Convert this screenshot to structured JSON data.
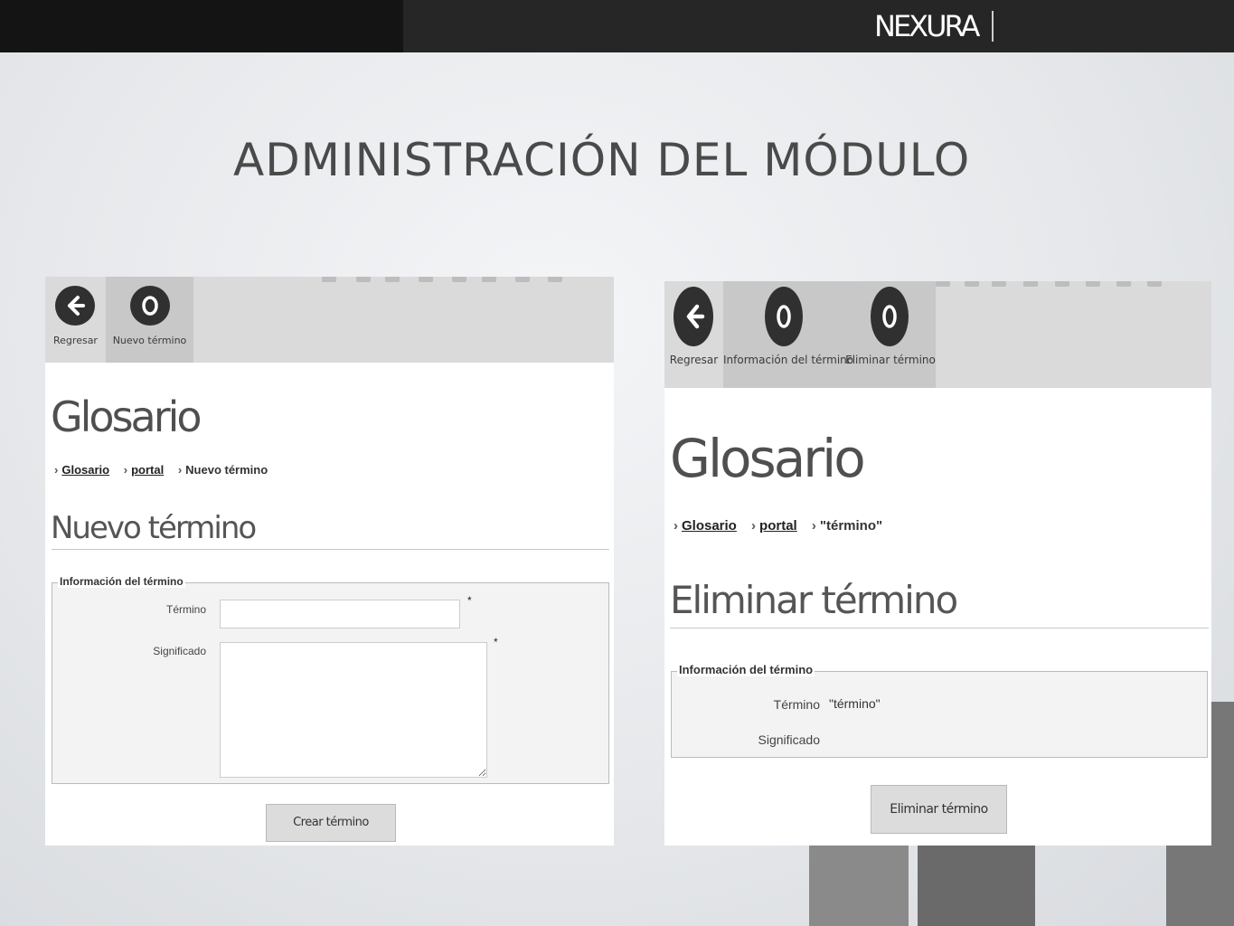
{
  "brand": {
    "name": "NEXURA"
  },
  "slide": {
    "title": "ADMINISTRACIÓN DEL MÓDULO"
  },
  "left": {
    "toolbar": [
      {
        "label": "Regresar",
        "icon": "arrow-left-icon"
      },
      {
        "label": "Nuevo término",
        "icon": "circle-icon"
      }
    ],
    "heading": "Glosario",
    "breadcrumb": {
      "item1": "Glosario",
      "item2": "portal",
      "current": "Nuevo término"
    },
    "section_title": "Nuevo término",
    "fieldset_legend": "Información del término",
    "field_termino_label": "Término",
    "field_termino_value": "",
    "field_significado_label": "Significado",
    "field_significado_value": "",
    "required_mark": "*",
    "submit_label": "Crear término"
  },
  "right": {
    "toolbar": [
      {
        "label": "Regresar",
        "icon": "arrow-left-icon"
      },
      {
        "label": "Información del término",
        "icon": "circle-icon"
      },
      {
        "label": "Eliminar término",
        "icon": "circle-icon"
      }
    ],
    "heading": "Glosario",
    "breadcrumb": {
      "item1": "Glosario",
      "item2": "portal",
      "current": "\"término\""
    },
    "section_title": "Eliminar término",
    "fieldset_legend": "Información del término",
    "field_termino_label": "Término",
    "field_termino_value": "\"término\"",
    "field_significado_label": "Significado",
    "submit_label": "Eliminar término"
  },
  "colors": {
    "topbar": "#262626",
    "panel_dark": "#141414",
    "icon_circle": "#303030",
    "toolbar": "#dadada"
  }
}
